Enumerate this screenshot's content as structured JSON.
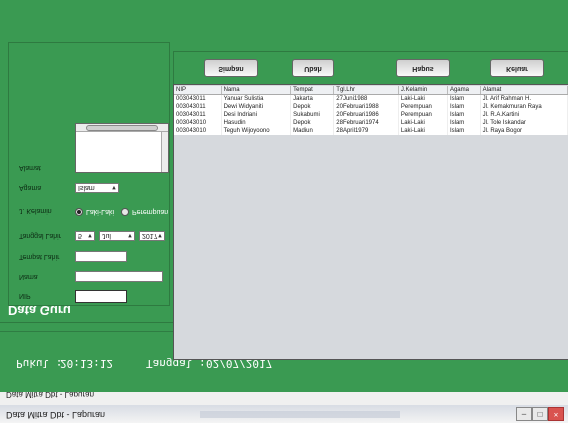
{
  "window": {
    "title": "Data Mitra Dbt - Lapuran",
    "menu": "Data Mitra Dbt - Lapuran"
  },
  "status": {
    "time_label": "Pukul :",
    "time_value": "20:13:12",
    "date_label": "Tanggal :",
    "date_value": "02/07/2017"
  },
  "section_title": "Data Guru",
  "form": {
    "nip_label": "NIP",
    "nip_value": "",
    "nama_label": "Nama",
    "nama_value": "",
    "tempat_label": "Tempat Lahir",
    "tempat_value": "",
    "tanggal_label": "Tanggal Lahir",
    "tgl_day": "5",
    "tgl_month": "Jul",
    "tgl_year": "2017",
    "jk_label": "J. Kelamin",
    "jk_options": [
      "Laki-Laki",
      "Perempuan"
    ],
    "agama_label": "Agama",
    "agama_value": "Islam",
    "alamat_label": "Alamat",
    "alamat_value": ""
  },
  "buttons": {
    "simpan": "Simpan",
    "ubah": "Ubah",
    "hapus": "Hapus",
    "keluar": "Keluar"
  },
  "table": {
    "columns": [
      "NIP",
      "Nama",
      "Tempat",
      "Tgl.Lhr",
      "J.Kelamin",
      "Agama",
      "Alamat"
    ],
    "rows": [
      [
        "003043011",
        "Yanuar Sulistia",
        "Jakarta",
        "27Juni1988",
        "Laki-Laki",
        "Islam",
        "Jl. Arif Rahman H."
      ],
      [
        "003043011",
        "Dewi Widyaniti",
        "Depok",
        "20Februari1988",
        "Perempuan",
        "Islam",
        "Jl. Kemakmuran Raya"
      ],
      [
        "003043011",
        "Desi Indriani",
        "Sukabumi",
        "20Februari1986",
        "Perempuan",
        "Islam",
        "Jl. R.A.Kartini"
      ],
      [
        "003043010",
        "Hasudin",
        "Depok",
        "28Februari1974",
        "Laki-Laki",
        "Islam",
        "Jl. Tole Iskandar"
      ],
      [
        "003043010",
        "Teguh Wijoyoono",
        "Madiun",
        "28April1979",
        "Laki-Laki",
        "Islam",
        "Jl. Raya Bogor"
      ]
    ]
  }
}
